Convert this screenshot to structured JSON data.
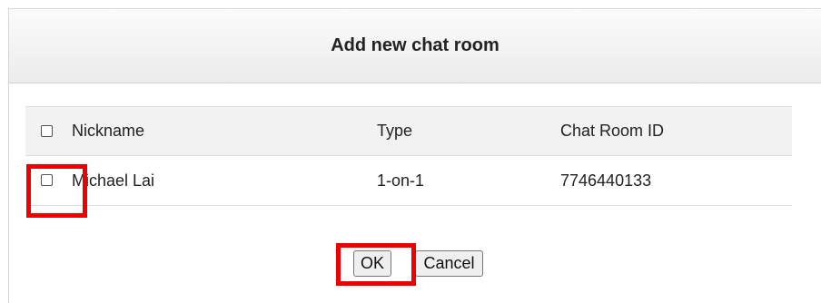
{
  "dialog": {
    "title": "Add new chat room"
  },
  "table": {
    "columns": [
      "Nickname",
      "Type",
      "Chat Room ID"
    ],
    "rows": [
      {
        "nickname": "Michael Lai",
        "type": "1-on-1",
        "chat_room_id": "7746440133",
        "checked": false
      }
    ],
    "select_all_checked": false
  },
  "buttons": {
    "ok_label": "OK",
    "cancel_label": "Cancel"
  },
  "highlight": {
    "color": "#ee0000"
  }
}
